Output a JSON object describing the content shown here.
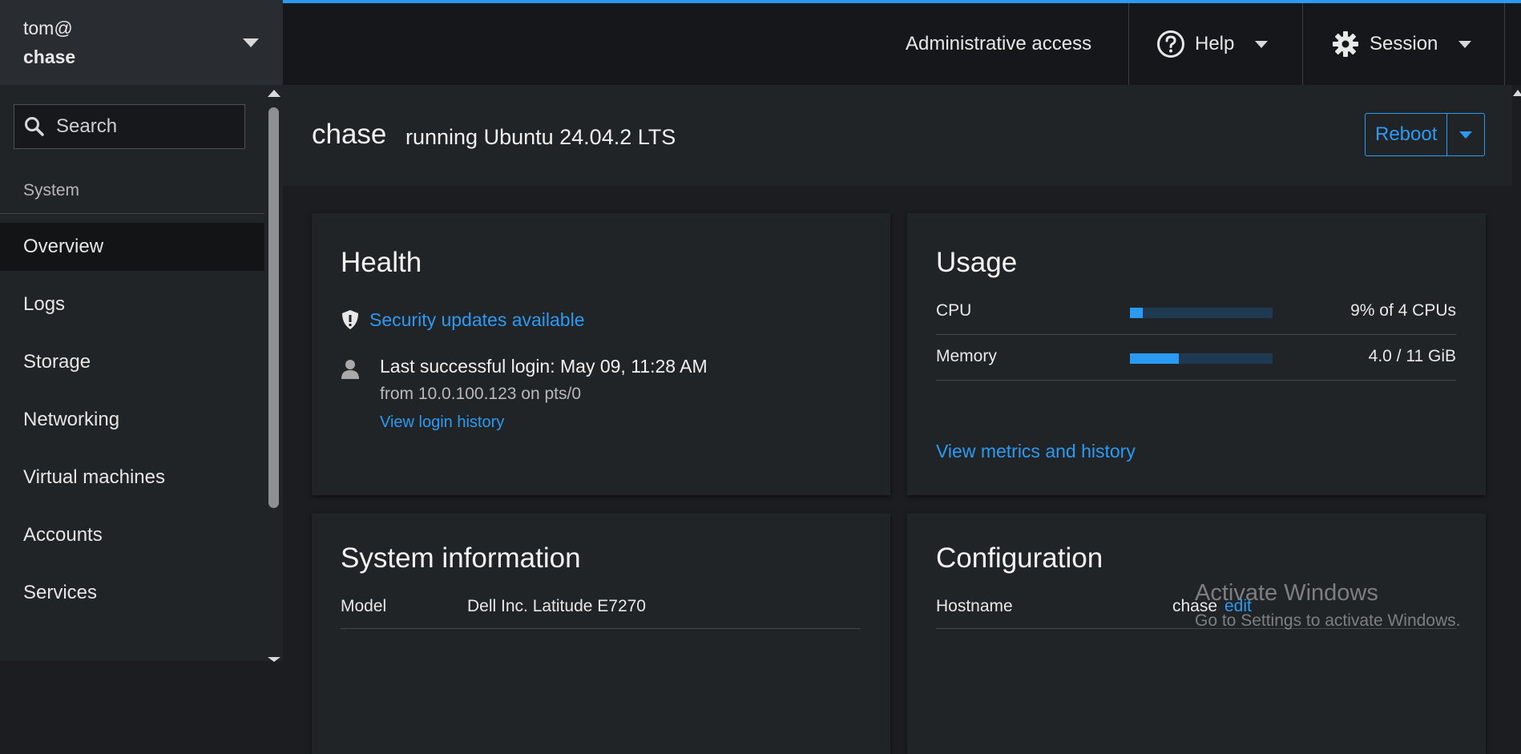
{
  "host_switcher": {
    "user": "tom@",
    "hostname": "chase"
  },
  "search": {
    "placeholder": "Search"
  },
  "sidebar": {
    "section": "System",
    "items": [
      {
        "label": "Overview"
      },
      {
        "label": "Logs"
      },
      {
        "label": "Storage"
      },
      {
        "label": "Networking"
      },
      {
        "label": "Virtual machines"
      },
      {
        "label": "Accounts"
      },
      {
        "label": "Services"
      }
    ]
  },
  "topbar": {
    "admin": "Administrative access",
    "help": "Help",
    "session": "Session"
  },
  "page": {
    "hostname": "chase",
    "os": "running Ubuntu 24.04.2 LTS",
    "reboot": "Reboot"
  },
  "health": {
    "title": "Health",
    "security": "Security updates available",
    "login": "Last successful login: May 09, 11:28 AM",
    "login_from": "from 10.0.100.123 on pts/0",
    "login_history": "View login history"
  },
  "usage": {
    "title": "Usage",
    "cpu": {
      "label": "CPU",
      "value": "9% of 4 CPUs",
      "fraction": 0.09
    },
    "memory": {
      "label": "Memory",
      "value": "4.0 / 11 GiB",
      "fraction": 0.34
    },
    "metrics_link": "View metrics and history"
  },
  "sysinfo": {
    "title": "System information",
    "model_label": "Model",
    "model_value": "Dell Inc. Latitude E7270"
  },
  "config": {
    "title": "Configuration",
    "hostname_label": "Hostname",
    "hostname_value": "chase",
    "edit": "edit"
  },
  "watermark": {
    "title": "Activate Windows",
    "subtitle": "Go to Settings to activate Windows."
  },
  "colors": {
    "accent": "#2b9af3",
    "topbar_border": "#2b9af3"
  }
}
